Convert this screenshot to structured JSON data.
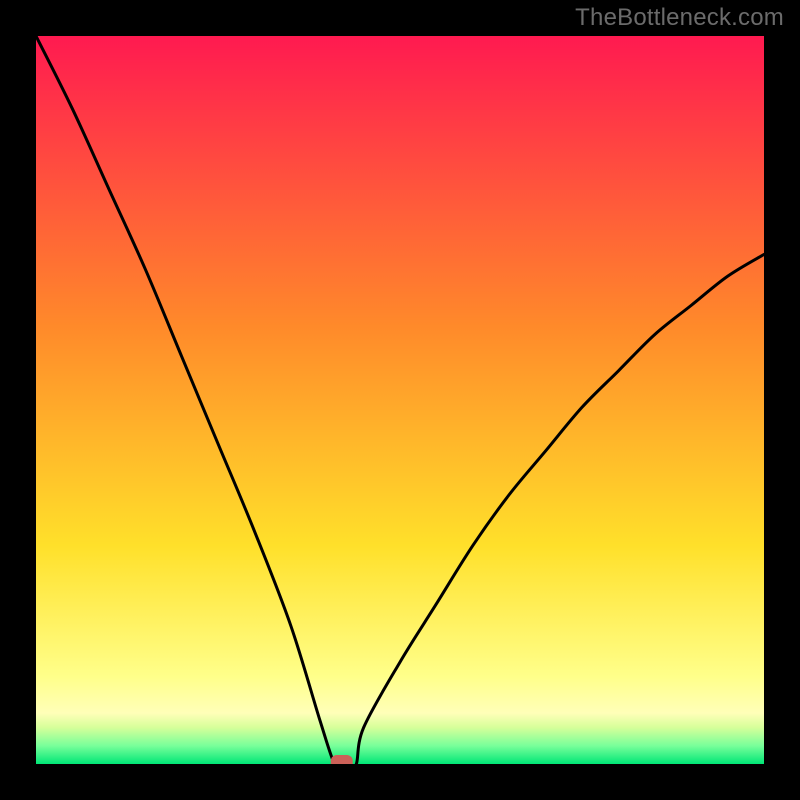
{
  "watermark": "TheBottleneck.com",
  "chart_data": {
    "type": "line",
    "title": "",
    "xlabel": "",
    "ylabel": "",
    "xlim": [
      0,
      100
    ],
    "ylim": [
      0,
      100
    ],
    "grid": false,
    "legend": false,
    "series": [
      {
        "name": "bottleneck-curve",
        "x": [
          0,
          5,
          10,
          15,
          20,
          25,
          30,
          35,
          39,
          41,
          42,
          43,
          44,
          45,
          50,
          55,
          60,
          65,
          70,
          75,
          80,
          85,
          90,
          95,
          100
        ],
        "y": [
          100,
          90,
          79,
          68,
          56,
          44,
          32,
          19,
          6,
          0,
          0,
          0,
          0,
          5,
          14,
          22,
          30,
          37,
          43,
          49,
          54,
          59,
          63,
          67,
          70
        ]
      }
    ],
    "annotations": [
      {
        "name": "min-marker",
        "x": 42,
        "y": 0
      }
    ],
    "background_gradient": {
      "stops": [
        {
          "offset": 0.0,
          "color": "#ff1a50"
        },
        {
          "offset": 0.4,
          "color": "#ff8a2a"
        },
        {
          "offset": 0.7,
          "color": "#ffe02a"
        },
        {
          "offset": 0.88,
          "color": "#ffff8a"
        },
        {
          "offset": 0.93,
          "color": "#ffffb8"
        },
        {
          "offset": 0.95,
          "color": "#d6ff9a"
        },
        {
          "offset": 0.975,
          "color": "#78ff9a"
        },
        {
          "offset": 1.0,
          "color": "#00e676"
        }
      ]
    }
  }
}
